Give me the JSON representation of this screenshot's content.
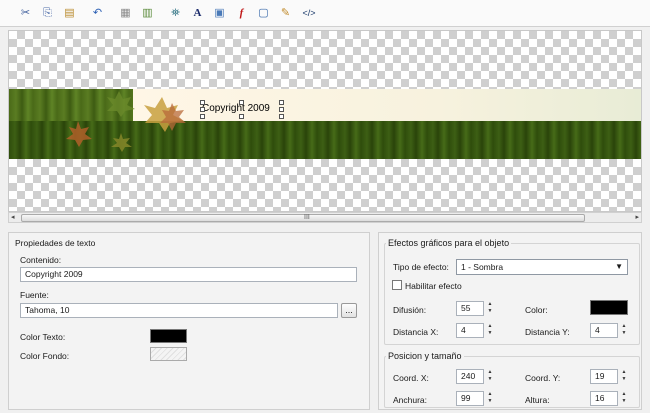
{
  "toolbar": {
    "icons": [
      "cut-icon",
      "copy-icon",
      "paste-icon",
      "undo-icon",
      "bring-front-icon",
      "send-back-icon",
      "insert-image-icon",
      "text-icon",
      "picture-icon",
      "flash-icon",
      "shape-icon",
      "clipart-icon",
      "html-code-icon"
    ],
    "glyphs": [
      "✂",
      "⎘",
      "📋",
      "↶",
      "▦",
      "▥",
      "⛯",
      "A",
      "▣",
      "f",
      "▢",
      "✎",
      "</>"
    ]
  },
  "canvas": {
    "banner_text": "Copyright 2009"
  },
  "text_props": {
    "title": "Propiedades de texto",
    "content_label": "Contenido:",
    "content_value": "Copyright 2009",
    "font_label": "Fuente:",
    "font_value": "Tahoma, 10",
    "font_button": "...",
    "text_color_label": "Color Texto:",
    "text_color": "#000000",
    "bg_color_label": "Color Fondo:"
  },
  "effects": {
    "title": "Efectos gráficos para el objeto",
    "type_label": "Tipo de efecto:",
    "type_value": "1 - Sombra",
    "enable_label": "Habilitar efecto",
    "diffusion_label": "Difusión:",
    "diffusion_value": "55",
    "color_label": "Color:",
    "color_value": "#000000",
    "dist_x_label": "Distancia X:",
    "dist_x_value": "4",
    "dist_y_label": "Distancia Y:",
    "dist_y_value": "4"
  },
  "position": {
    "title": "Posicion y tamaño",
    "coord_x_label": "Coord. X:",
    "coord_x_value": "240",
    "coord_y_label": "Coord. Y:",
    "coord_y_value": "19",
    "width_label": "Anchura:",
    "width_value": "99",
    "height_label": "Altura:",
    "height_value": "16"
  },
  "scrollbar": {
    "grip": "III"
  }
}
